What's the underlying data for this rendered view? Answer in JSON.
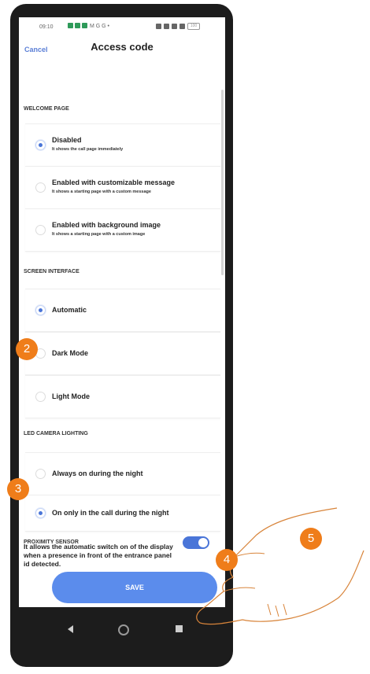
{
  "status_bar": {
    "time": "09:10",
    "left_letters": "M G G •",
    "battery": "100"
  },
  "header": {
    "cancel": "Cancel",
    "title": "Access code"
  },
  "sections": {
    "welcome": "WELCOME PAGE",
    "screen": "SCREEN INTERFACE",
    "led": "LED CAMERA LIGHTING",
    "proximity": "PROXIMITY SENSOR"
  },
  "welcome_options": [
    {
      "label": "Disabled",
      "desc": "It shows the call page immediately",
      "selected": true
    },
    {
      "label": "Enabled with customizable message",
      "desc": "It shows a starting page with a custom message",
      "selected": false
    },
    {
      "label": "Enabled with background image",
      "desc": "It shows a starting page with a custom image",
      "selected": false
    }
  ],
  "screen_options": [
    {
      "label": "Automatic",
      "selected": true
    },
    {
      "label": "Dark Mode",
      "selected": false
    },
    {
      "label": "Light Mode",
      "selected": false
    }
  ],
  "led_options": [
    {
      "label": "Always on during the night",
      "selected": false
    },
    {
      "label": "On only in the call during the night",
      "selected": true
    }
  ],
  "proximity": {
    "text": "It allows the automatic switch on of the display when a presence in front of the entrance panel id detected.",
    "enabled": true
  },
  "save_label": "SAVE",
  "badges": [
    "2",
    "3",
    "4",
    "5"
  ]
}
